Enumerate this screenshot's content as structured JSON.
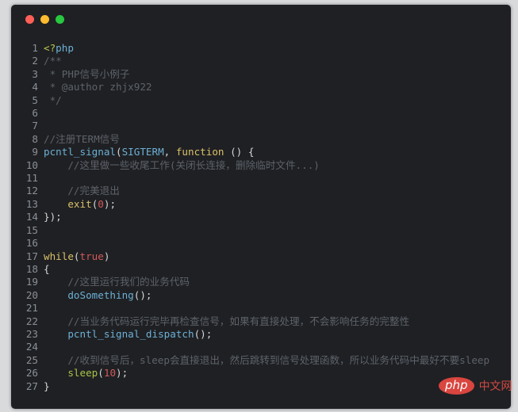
{
  "window": {
    "dots": [
      "#fe5f57",
      "#febc2e",
      "#28c840"
    ]
  },
  "watermark": {
    "pill": "php",
    "text": "中文网"
  },
  "code": [
    [
      [
        "tag",
        "<?"
      ],
      [
        "fn",
        "php"
      ]
    ],
    [
      [
        "cm",
        "/**"
      ]
    ],
    [
      [
        "cm",
        " * PHP信号小例子"
      ]
    ],
    [
      [
        "cm",
        " * @author zhjx922"
      ]
    ],
    [
      [
        "cm",
        " */"
      ]
    ],
    [],
    [],
    [
      [
        "cm",
        "//注册TERM信号"
      ]
    ],
    [
      [
        "fn",
        "pcntl_signal"
      ],
      [
        "pl",
        "("
      ],
      [
        "fn",
        "SIGTERM"
      ],
      [
        "pl",
        ", "
      ],
      [
        "kw",
        "function"
      ],
      [
        "pl",
        " () {"
      ]
    ],
    [
      [
        "cm",
        "    //这里做一些收尾工作(关闭长连接，删除临时文件...)"
      ]
    ],
    [],
    [
      [
        "cm",
        "    //完美退出"
      ]
    ],
    [
      [
        "pl",
        "    "
      ],
      [
        "kw",
        "exit"
      ],
      [
        "pl",
        "("
      ],
      [
        "num",
        "0"
      ],
      [
        "pl",
        ");"
      ]
    ],
    [
      [
        "pl",
        "});"
      ]
    ],
    [],
    [],
    [
      [
        "kw",
        "while"
      ],
      [
        "pl",
        "("
      ],
      [
        "num",
        "true"
      ],
      [
        "pl",
        ")"
      ]
    ],
    [
      [
        "pl",
        "{"
      ]
    ],
    [
      [
        "cm",
        "    //这里运行我们的业务代码"
      ]
    ],
    [
      [
        "pl",
        "    "
      ],
      [
        "fn",
        "doSomething"
      ],
      [
        "pl",
        "();"
      ]
    ],
    [],
    [
      [
        "cm",
        "    //当业务代码运行完毕再检查信号，如果有直接处理，不会影响任务的完整性"
      ]
    ],
    [
      [
        "pl",
        "    "
      ],
      [
        "fn",
        "pcntl_signal_dispatch"
      ],
      [
        "pl",
        "();"
      ]
    ],
    [],
    [
      [
        "cm",
        "    //收到信号后，sleep会直接退出，然后跳转到信号处理函数，所以业务代码中最好不要sleep"
      ]
    ],
    [
      [
        "pl",
        "    "
      ],
      [
        "gr",
        "sleep"
      ],
      [
        "pl",
        "("
      ],
      [
        "num",
        "10"
      ],
      [
        "pl",
        ");"
      ]
    ],
    [
      [
        "pl",
        "}"
      ]
    ]
  ]
}
